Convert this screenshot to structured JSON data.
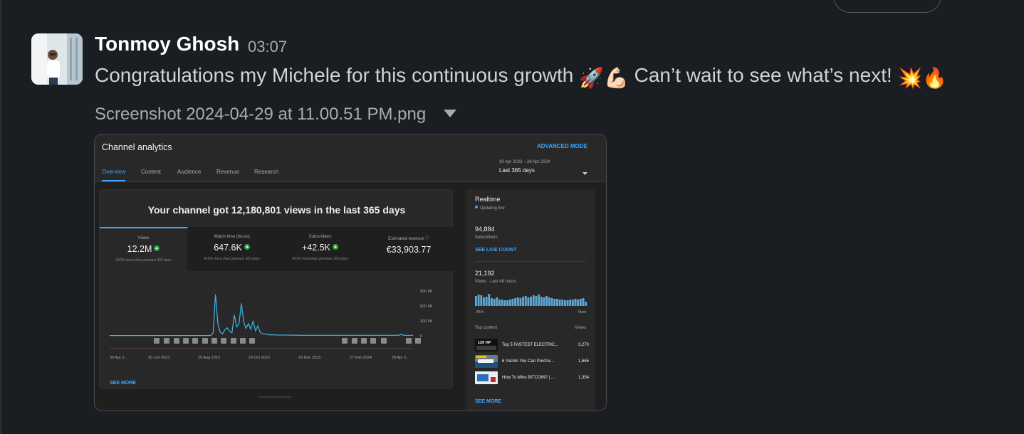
{
  "message": {
    "author": "Tonmoy Ghosh",
    "time": "03:07",
    "text_part1": "Congratulations my Michele for this continuous growth ",
    "emoji_1": "🚀",
    "emoji_2": "💪🏻",
    "text_part2": " Can’t wait to see what’s next! ",
    "emoji_3": "💥",
    "emoji_4": "🔥",
    "filename": "Screenshot 2024-04-29 at 11.00.51 PM.png"
  },
  "analytics": {
    "title": "Channel analytics",
    "advanced_mode": "ADVANCED MODE",
    "tabs": [
      "Overview",
      "Content",
      "Audience",
      "Revenue",
      "Research"
    ],
    "date_sub": "30 Apr 2023 – 28 Apr 2024",
    "date_main": "Last 365 days",
    "headline": "Your channel got 12,180,801 views in the last 365 days",
    "metrics": [
      {
        "label": "Views",
        "value": "12.2M",
        "note": "232% more than previous 365 days"
      },
      {
        "label": "Watch time (hours)",
        "value": "647.6K",
        "note": "416% more than previous 365 days"
      },
      {
        "label": "Subscribers",
        "value": "+42.5K",
        "note": "491% more than previous 365 days"
      },
      {
        "label": "Estimated revenue",
        "value": "€33,903.77",
        "note": ""
      }
    ],
    "see_more": "SEE MORE",
    "realtime": {
      "title": "Realtime",
      "live": "Updating live",
      "subscribers": "94,884",
      "subscribers_label": "Subscribers",
      "see_live_count": "SEE LIVE COUNT",
      "views": "21,192",
      "views_label": "Views · Last 48 hours",
      "axis_left": "-48 h",
      "axis_right": "Now",
      "top_content_label": "Top content",
      "views_col_label": "Views",
      "thumb_caption": "120 HP",
      "top_content": [
        {
          "title": "Top 5 FASTEST ELECTRIC...",
          "views": "3,270"
        },
        {
          "title": "6 Yachts You Can Purcha...",
          "views": "1,665"
        },
        {
          "title": "How To Mine BITCOIN? | ...",
          "views": "1,354"
        }
      ],
      "see_more": "SEE MORE"
    }
  },
  "chart_data": {
    "type": "line",
    "x_ticks": [
      "30 Apr 2...",
      "30 Jun 2023",
      "29 Aug 2023",
      "29 Oct 2023",
      "29 Dec 2023",
      "27 Feb 2024",
      "28 Apr 2..."
    ],
    "y_ticks": [
      "900.0K",
      "600.0K",
      "300.0K",
      "0"
    ],
    "ylim": [
      0,
      900000
    ],
    "series": [
      {
        "values": [
          5000,
          5000,
          5000,
          5000,
          5000,
          5000,
          5000,
          5000,
          5000,
          5000,
          5000,
          5000,
          5000,
          5000,
          5000,
          5000,
          5000,
          5000,
          5000,
          5000,
          5000,
          5000,
          5000,
          5000,
          5000,
          5000,
          5000,
          5000,
          5000,
          5000,
          5000,
          5000,
          5000,
          5000,
          5000,
          5000,
          5000,
          5000,
          5000,
          5000,
          5000,
          5000,
          5000,
          8000,
          60000,
          830000,
          250000,
          70000,
          40000,
          120000,
          160000,
          90000,
          60000,
          420000,
          180000,
          240000,
          650000,
          280000,
          150000,
          240000,
          130000,
          300000,
          100000,
          200000,
          70000,
          40000,
          40000,
          30000,
          20000,
          20000,
          20000,
          15000,
          15000,
          15000,
          15000,
          15000,
          15000,
          12000,
          12000,
          12000,
          12000,
          10000,
          10000,
          10000,
          10000,
          10000,
          10000,
          10000,
          10000,
          10000,
          10000,
          10000,
          10000,
          10000,
          10000,
          10000,
          10000,
          10000,
          10000,
          10000,
          10000,
          10000,
          10000,
          10000,
          10000,
          10000,
          10000,
          10000,
          10000,
          10000,
          10000,
          10000,
          10000,
          10000,
          10000,
          10000,
          10000,
          10000,
          10000,
          10000,
          10000,
          10000,
          12000,
          10000,
          30000,
          10000,
          10000,
          10000,
          10000,
          10000
        ]
      }
    ],
    "grid": true
  },
  "colors": {
    "slack_bg": "#1a1d21",
    "yt_accent": "#3ea6ff",
    "yt_line": "#41b5e6",
    "up_green": "#2ba640"
  }
}
